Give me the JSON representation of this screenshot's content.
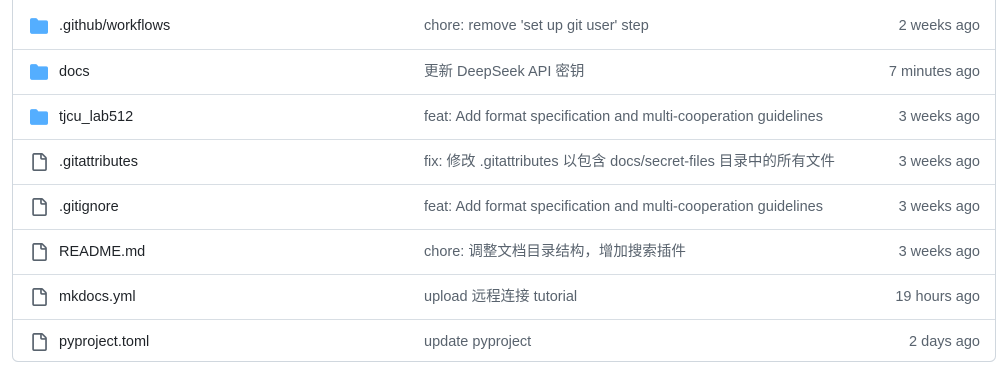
{
  "colors": {
    "folder_icon": "#54aeff",
    "file_icon": "#59636e",
    "name_text": "#1f2328",
    "muted_text": "#59636e",
    "border": "#d0d7de"
  },
  "files": [
    {
      "type": "folder",
      "icon": "folder-icon",
      "name": ".github/workflows",
      "message": "chore: remove 'set up git user' step",
      "time": "2 weeks ago"
    },
    {
      "type": "folder",
      "icon": "folder-icon",
      "name": "docs",
      "message": "更新 DeepSeek API 密钥",
      "time": "7 minutes ago"
    },
    {
      "type": "folder",
      "icon": "folder-icon",
      "name": "tjcu_lab512",
      "message": "feat: Add format specification and multi-cooperation guidelines",
      "time": "3 weeks ago"
    },
    {
      "type": "file",
      "icon": "file-icon",
      "name": ".gitattributes",
      "message": "fix: 修改 .gitattributes 以包含 docs/secret-files 目录中的所有文件",
      "time": "3 weeks ago"
    },
    {
      "type": "file",
      "icon": "file-icon",
      "name": ".gitignore",
      "message": "feat: Add format specification and multi-cooperation guidelines",
      "time": "3 weeks ago"
    },
    {
      "type": "file",
      "icon": "file-icon",
      "name": "README.md",
      "message": "chore: 调整文档目录结构，增加搜索插件",
      "time": "3 weeks ago"
    },
    {
      "type": "file",
      "icon": "file-icon",
      "name": "mkdocs.yml",
      "message": "upload 远程连接 tutorial",
      "time": "19 hours ago"
    },
    {
      "type": "file",
      "icon": "file-icon",
      "name": "pyproject.toml",
      "message": "update pyproject",
      "time": "2 days ago"
    }
  ]
}
